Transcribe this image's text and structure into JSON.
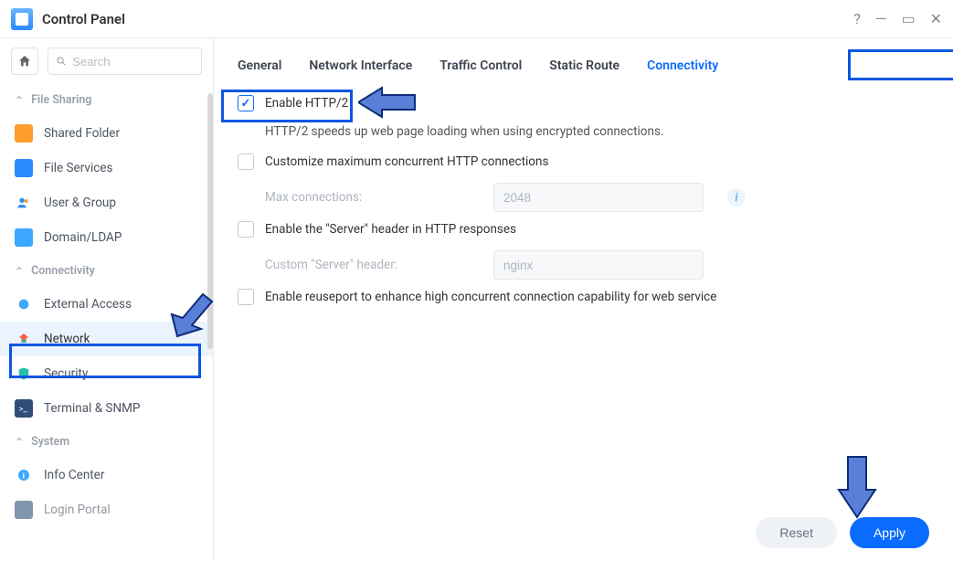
{
  "app": {
    "title": "Control Panel"
  },
  "search": {
    "placeholder": "Search"
  },
  "sidebar": {
    "sections": {
      "file_sharing": {
        "label": "File Sharing"
      },
      "connectivity": {
        "label": "Connectivity"
      },
      "system": {
        "label": "System"
      }
    },
    "items": {
      "shared_folder": "Shared Folder",
      "file_services": "File Services",
      "user_group": "User & Group",
      "domain_ldap": "Domain/LDAP",
      "external_access": "External Access",
      "network": "Network",
      "security": "Security",
      "terminal_snmp": "Terminal & SNMP",
      "info_center": "Info Center",
      "login_portal": "Login Portal"
    }
  },
  "tabs": {
    "general": "General",
    "network_interface": "Network Interface",
    "traffic_control": "Traffic Control",
    "static_route": "Static Route",
    "connectivity": "Connectivity"
  },
  "content": {
    "enable_http2": {
      "label": "Enable HTTP/2",
      "checked": true
    },
    "http2_help": "HTTP/2 speeds up web page loading when using encrypted connections.",
    "customize_max": {
      "label": "Customize maximum concurrent HTTP connections",
      "checked": false
    },
    "max_conn_label": "Max connections:",
    "max_conn_value": "2048",
    "enable_server_header": {
      "label": "Enable the \"Server\" header in HTTP responses",
      "checked": false
    },
    "custom_server_label": "Custom \"Server\" header:",
    "custom_server_value": "nginx",
    "enable_reuseport": {
      "label": "Enable reuseport to enhance high concurrent connection capability for web service",
      "checked": false
    }
  },
  "footer": {
    "reset": "Reset",
    "apply": "Apply"
  }
}
